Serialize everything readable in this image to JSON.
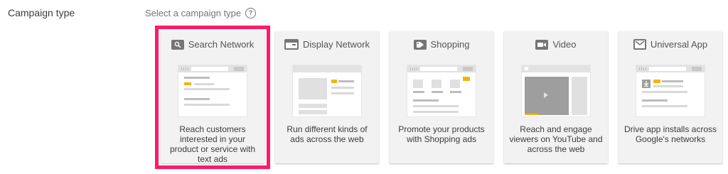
{
  "section": {
    "label": "Campaign type"
  },
  "prompt": {
    "text": "Select a campaign type",
    "help_icon": "?"
  },
  "cards": [
    {
      "title": "Search Network",
      "icon": "search-icon",
      "description": "Reach customers interested in your product or service with text ads",
      "selected": true
    },
    {
      "title": "Display Network",
      "icon": "display-icon",
      "description": "Run different kinds of ads across the web",
      "selected": false
    },
    {
      "title": "Shopping",
      "icon": "tag-icon",
      "description": "Promote your products with Shopping ads",
      "selected": false
    },
    {
      "title": "Video",
      "icon": "video-icon",
      "description": "Reach and engage viewers on YouTube and across the web",
      "selected": false
    },
    {
      "title": "Universal App",
      "icon": "app-icon",
      "description": "Drive app installs across Google's networks",
      "selected": false
    }
  ],
  "colors": {
    "selected_outline": "#ff1a6a",
    "accent_yellow": "#f4b400"
  }
}
